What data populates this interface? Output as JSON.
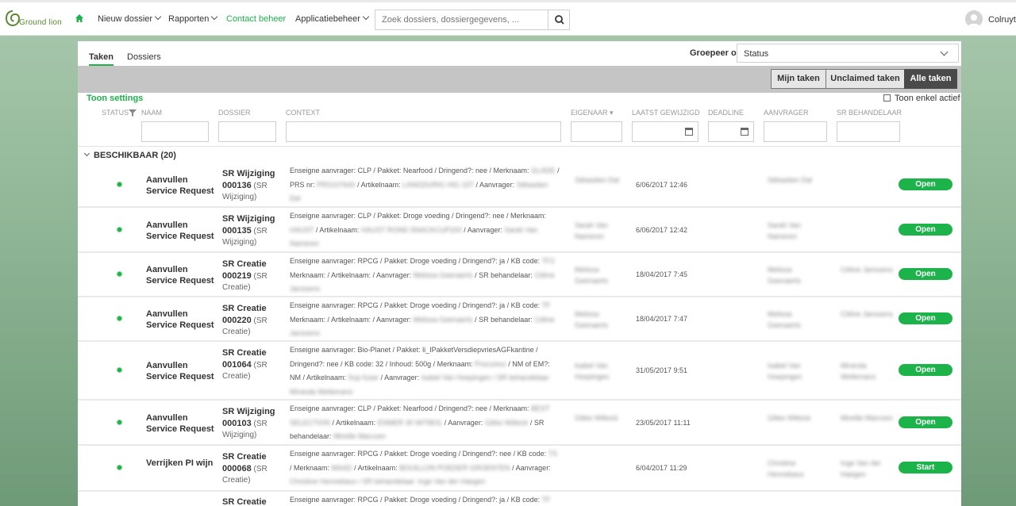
{
  "brand": {
    "logo_text": "Ground lion",
    "accent": "#1bb34a"
  },
  "nav": {
    "items": [
      {
        "label": "Nieuw dossier",
        "dropdown": true,
        "active": false
      },
      {
        "label": "Rapporten",
        "dropdown": true,
        "active": false
      },
      {
        "label": "Contact beheer",
        "dropdown": false,
        "active": true
      },
      {
        "label": "Applicatiebeheer",
        "dropdown": true,
        "active": false
      }
    ],
    "search_placeholder": "Zoek dossiers, dossiergegevens, ...",
    "user_name": "Colruyt"
  },
  "tabs": [
    {
      "label": "Taken",
      "active": true
    },
    {
      "label": "Dossiers",
      "active": false
    }
  ],
  "group_by": {
    "label": "Groepeer op",
    "value": "Status"
  },
  "filters": [
    {
      "label": "Mijn taken",
      "active": false
    },
    {
      "label": "Unclaimed taken",
      "active": false
    },
    {
      "label": "Alle taken",
      "active": true
    }
  ],
  "toon_settings": "Toon settings",
  "toon_actief": "Toon enkel actief",
  "columns": {
    "status": "STATUS",
    "naam": "NAAM",
    "dossier": "DOSSIER",
    "context": "CONTEXT",
    "eigenaar": "EIGENAAR ▾",
    "laatst": "LAATST GEWIJZIGD",
    "deadline": "DEADLINE",
    "aanvrager": "AANVRAGER",
    "behandelaar": "SR BEHANDELAAR"
  },
  "group_header": "BESCHIKBAAR (20)",
  "rows": [
    {
      "naam": "Aanvullen Service Request",
      "sr": "SR Wijziging",
      "nr": "000136",
      "type": "(SR Wijziging)",
      "ctx_l1": "Enseigne aanvrager: CLP / Pakket: Nearfood / Dringend?: nee / Merknaam:",
      "ctx_b1": "GLADE",
      "ctx_l2": "/ PRS nr:",
      "ctx_b2": "PRS107640",
      "ctx_l3": "/ Artikelnaam:",
      "ctx_b3": "LANGDURIG HIG 15T",
      "ctx_l4": "/ Aanvrager:",
      "ctx_b4": "Sébastien Dal",
      "eigenaar": "Sébastien Dal",
      "date": "6/06/2017 12:46",
      "aanvrager": "Sébastien Dal",
      "behandelaar": "",
      "action": "Open"
    },
    {
      "naam": "Aanvullen Service Request",
      "sr": "SR Wijziging",
      "nr": "000135",
      "type": "(SR Wijziging)",
      "ctx_l1": "Enseigne aanvrager: CLP / Pakket: Droge voeding / Dringend?: nee / Merknaam:",
      "ctx_b1": "HAUST",
      "ctx_l2": "/ Artikelnaam:",
      "ctx_b2": "HAUST ROND SNACKCUP200",
      "ctx_l3": "/ Aanvrager:",
      "ctx_b3": "Sarah Van Nameren",
      "ctx_l4": "",
      "ctx_b4": "",
      "eigenaar": "Sarah Van Nameren",
      "date": "6/06/2017 12:42",
      "aanvrager": "Sarah Van Nameren",
      "behandelaar": "",
      "action": "Open"
    },
    {
      "naam": "Aanvullen Service Request",
      "sr": "SR Creatie",
      "nr": "000219",
      "type": "(SR Creatie)",
      "ctx_l1": "Enseigne aanvrager: RPCG / Pakket: Droge voeding / Dringend?: ja / KB code:",
      "ctx_b1": "TF2",
      "ctx_l2": "Merknaam: / Artikelnaam: / Aanvrager:",
      "ctx_b2": "Melissa Geenaerts",
      "ctx_l3": "/ SR behandelaar:",
      "ctx_b3": "Céline Janssens",
      "ctx_l4": "",
      "ctx_b4": "",
      "eigenaar": "Melissa Geenaerts",
      "date": "18/04/2017 7:45",
      "aanvrager": "Melissa Geenaerts",
      "behandelaar": "Céline Janssens",
      "action": "Open"
    },
    {
      "naam": "Aanvullen Service Request",
      "sr": "SR Creatie",
      "nr": "000220",
      "type": "(SR Creatie)",
      "ctx_l1": "Enseigne aanvrager: RPCG / Pakket: Droge voeding / Dringend?: ja / KB code:",
      "ctx_b1": "TF",
      "ctx_l2": "Merknaam: / Artikelnaam: / Aanvrager:",
      "ctx_b2": "Melissa Geenaerts",
      "ctx_l3": "/ SR behandelaar:",
      "ctx_b3": "Céline Janssens",
      "ctx_l4": "",
      "ctx_b4": "",
      "eigenaar": "Melissa Geenaerts",
      "date": "18/04/2017 7:47",
      "aanvrager": "Melissa Geenaerts",
      "behandelaar": "Céline Janssens",
      "action": "Open"
    },
    {
      "naam": "Aanvullen Service Request",
      "sr": "SR Creatie",
      "nr": "001064",
      "type": "(SR Creatie)",
      "ctx_l1": "Enseigne aanvrager: Bio-Planet / Pakket: li_IPakketVersdiepvriesAGFkantine /",
      "ctx_b1": "",
      "ctx_l2": "Dringend?: nee / KB code: 32 / Inhoud: 500g / Merknaam:",
      "ctx_b2": "Procureur",
      "ctx_l3": "/ NM of EM?: NM / Artikelnaam:",
      "ctx_b3": "Sup fuser",
      "ctx_l4": "/ Aanvrager:",
      "ctx_b4": "Isabel Van Hoepingen / SR behandelaar: Miranda Wellemans",
      "eigenaar": "Isabel Van Hoepingen",
      "date": "31/05/2017 9:51",
      "aanvrager": "Isabel Van Hoepingen",
      "behandelaar": "Miranda Wellemans",
      "action": "Open"
    },
    {
      "naam": "Aanvullen Service Request",
      "sr": "SR Wijziging",
      "nr": "000103",
      "type": "(SR Wijziging)",
      "ctx_l1": "Enseigne aanvrager: CLP / Pakket: Nearfood / Dringend?: nee / Merknaam:",
      "ctx_b1": "BEST SELECTION",
      "ctx_l2": "/ Artikelnaam:",
      "ctx_b2": "ENMER 30 WITBOL",
      "ctx_l3": "/ Aanvrager:",
      "ctx_b3": "Gilles Wittock",
      "ctx_l4": "/ SR behandelaar:",
      "ctx_b4": "Mireille Marcoen",
      "eigenaar": "Gilles Wittock",
      "date": "23/05/2017 11:11",
      "aanvrager": "Gilles Wittock",
      "behandelaar": "Mireille Marcoen",
      "action": "Open"
    },
    {
      "naam": "Verrijken PI wijn",
      "sr": "SR Creatie",
      "nr": "000068",
      "type": "(SR Creatie)",
      "ctx_l1": "Enseigne aanvrager: RPCG / Pakket: Droge voeding / Dringend?: nee / KB code:",
      "ctx_b1": "TS",
      "ctx_l2": "/ Merknaam:",
      "ctx_b2": "MAAD",
      "ctx_l3": "/ Artikelnaam:",
      "ctx_b3": "BOUILLON POEDER GROENTEN",
      "ctx_l4": "/ Aanvrager:",
      "ctx_b4": "Christine Hennebaux / SR behandelaar: Inge Van der Haegen",
      "eigenaar": "",
      "date": "6/04/2017 11:29",
      "aanvrager": "Christine Hennebaux",
      "behandelaar": "Inge Van der Haegen",
      "action": "Start"
    },
    {
      "naam": "",
      "sr": "SR Creatie",
      "nr": "",
      "type": "",
      "ctx_l1": "Enseigne aanvrager: RPCG / Pakket: Droge voeding / Dringend?: ja / KB code:",
      "ctx_b1": "TF",
      "ctx_l2": "",
      "ctx_b2": "",
      "ctx_l3": "",
      "ctx_b3": "",
      "ctx_l4": "",
      "ctx_b4": "",
      "eigenaar": "",
      "date": "",
      "aanvrager": "",
      "behandelaar": "",
      "action": ""
    }
  ]
}
